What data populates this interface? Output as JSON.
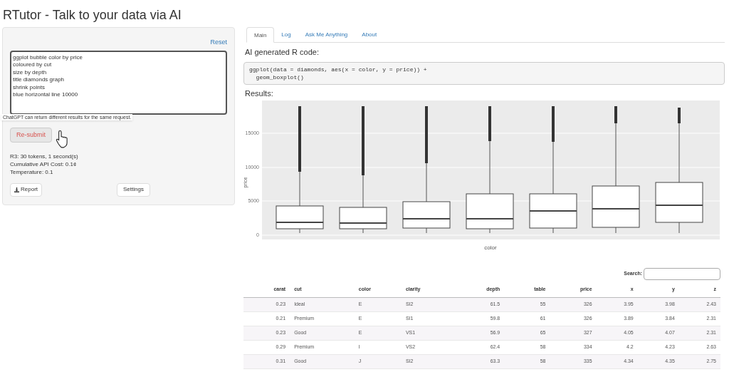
{
  "app_title": "RTutor - Talk to your data via AI",
  "left_panel": {
    "reset_link": "Reset",
    "prompt_lines": [
      "ggplot bubble color by price",
      "coloured by cut",
      "size by depth",
      "title diamonds graph",
      "shrink points",
      "blue horizontal line 10000"
    ],
    "tooltip": "ChatGPT can return different results for the same request.",
    "resubmit_button": "Re-submit",
    "stats": [
      "R3: 30 tokens, 1 second(s)",
      "Cumulative API Cost: 0.1¢",
      "Temperature: 0.1"
    ],
    "report_button": "Report",
    "settings_button": "Settings"
  },
  "tabs": [
    {
      "label": "Main",
      "selected": true
    },
    {
      "label": "Log",
      "selected": false
    },
    {
      "label": "Ask Me Anything",
      "selected": false
    },
    {
      "label": "About",
      "selected": false
    }
  ],
  "code_heading": "AI generated R code:",
  "code_lines": [
    "ggplot(data = diamonds, aes(x = color, y = price)) +",
    "  geom_boxplot()"
  ],
  "results_heading": "Results:",
  "plot": {
    "yticks": [
      "15000",
      "10000",
      "5000",
      "0"
    ],
    "ylabel": "price",
    "xlabel": "color"
  },
  "table": {
    "search_label": "Search:",
    "columns": [
      {
        "label": "carat"
      },
      {
        "label": "cut"
      },
      {
        "label": "color"
      },
      {
        "label": "clarity"
      },
      {
        "label": "depth"
      },
      {
        "label": "table"
      },
      {
        "label": "price"
      },
      {
        "label": "x"
      },
      {
        "label": "y"
      },
      {
        "label": "z"
      }
    ],
    "rows": [
      [
        "0.23",
        "Ideal",
        "E",
        "SI2",
        "61.5",
        "55",
        "326",
        "3.95",
        "3.98",
        "2.43"
      ],
      [
        "0.21",
        "Premium",
        "E",
        "SI1",
        "59.8",
        "61",
        "326",
        "3.89",
        "3.84",
        "2.31"
      ],
      [
        "0.23",
        "Good",
        "E",
        "VS1",
        "56.9",
        "65",
        "327",
        "4.05",
        "4.07",
        "2.31"
      ],
      [
        "0.29",
        "Premium",
        "I",
        "VS2",
        "62.4",
        "58",
        "334",
        "4.2",
        "4.23",
        "2.63"
      ],
      [
        "0.31",
        "Good",
        "J",
        "SI2",
        "63.3",
        "58",
        "335",
        "4.34",
        "4.35",
        "2.75"
      ]
    ]
  }
}
